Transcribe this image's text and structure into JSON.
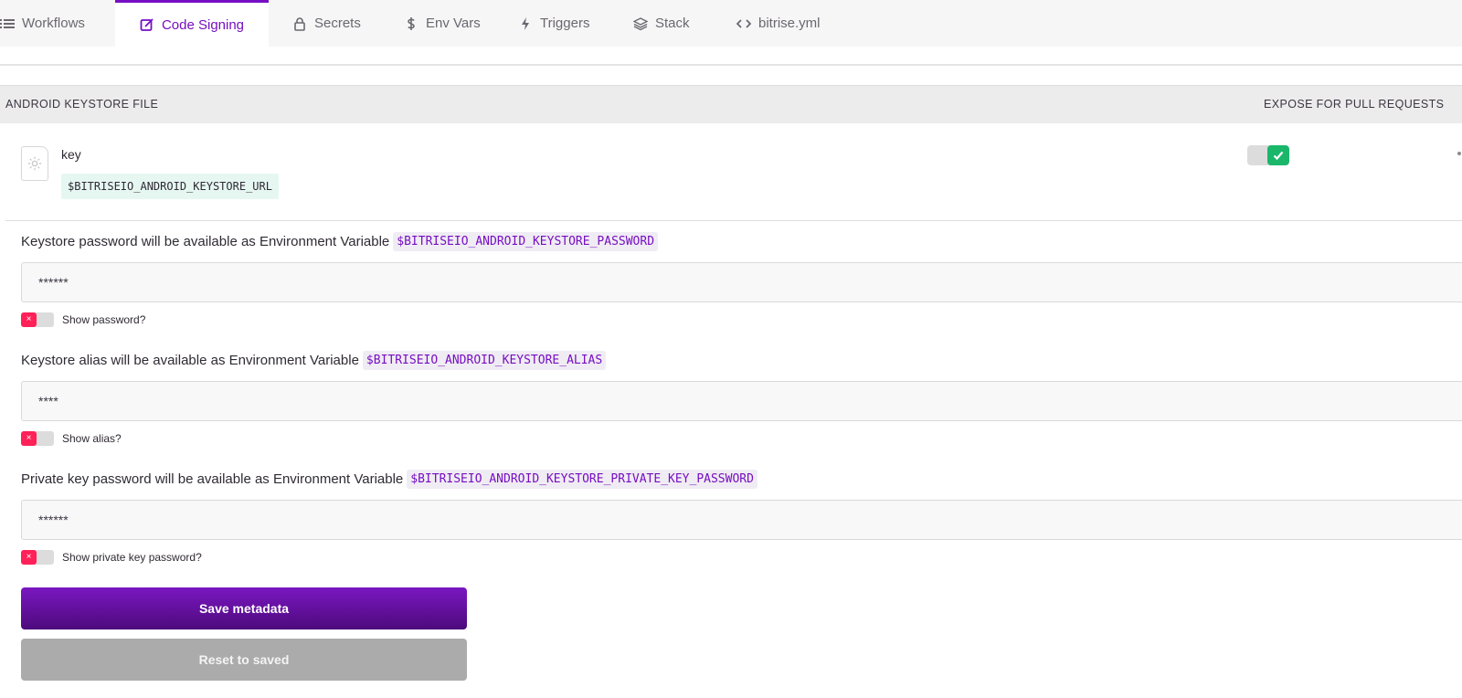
{
  "tabs": [
    {
      "label": "Workflows",
      "icon": "list-icon"
    },
    {
      "label": "Code Signing",
      "icon": "edit-icon",
      "active": true
    },
    {
      "label": "Secrets",
      "icon": "lock-icon"
    },
    {
      "label": "Env Vars",
      "icon": "dollar-icon"
    },
    {
      "label": "Triggers",
      "icon": "bolt-icon"
    },
    {
      "label": "Stack",
      "icon": "layers-icon"
    },
    {
      "label": "bitrise.yml",
      "icon": "code-icon"
    }
  ],
  "keystore": {
    "header_left": "ANDROID KEYSTORE FILE",
    "header_right": "EXPOSE FOR PULL REQUESTS",
    "file_name": "key",
    "file_var": "$BITRISEIO_ANDROID_KEYSTORE_URL",
    "expose_enabled": true
  },
  "fields": {
    "password": {
      "label": "Keystore password will be available as Environment Variable",
      "var": "$BITRISEIO_ANDROID_KEYSTORE_PASSWORD",
      "value": "******",
      "show_label": "Show password?",
      "show_enabled": false
    },
    "alias": {
      "label": "Keystore alias will be available as Environment Variable",
      "var": "$BITRISEIO_ANDROID_KEYSTORE_ALIAS",
      "value": "****",
      "show_label": "Show alias?",
      "show_enabled": false
    },
    "private_key": {
      "label": "Private key password will be available as Environment Variable",
      "var": "$BITRISEIO_ANDROID_KEYSTORE_PRIVATE_KEY_PASSWORD",
      "value": "******",
      "show_label": "Show private key password?",
      "show_enabled": false
    }
  },
  "toggle_off_glyph": "×",
  "buttons": {
    "save": "Save metadata",
    "reset": "Reset to saved"
  },
  "colors": {
    "accent": "#760fc3",
    "success": "#1ab76b",
    "danger": "#ff2158",
    "file_var_bg": "#e6f7f2"
  }
}
